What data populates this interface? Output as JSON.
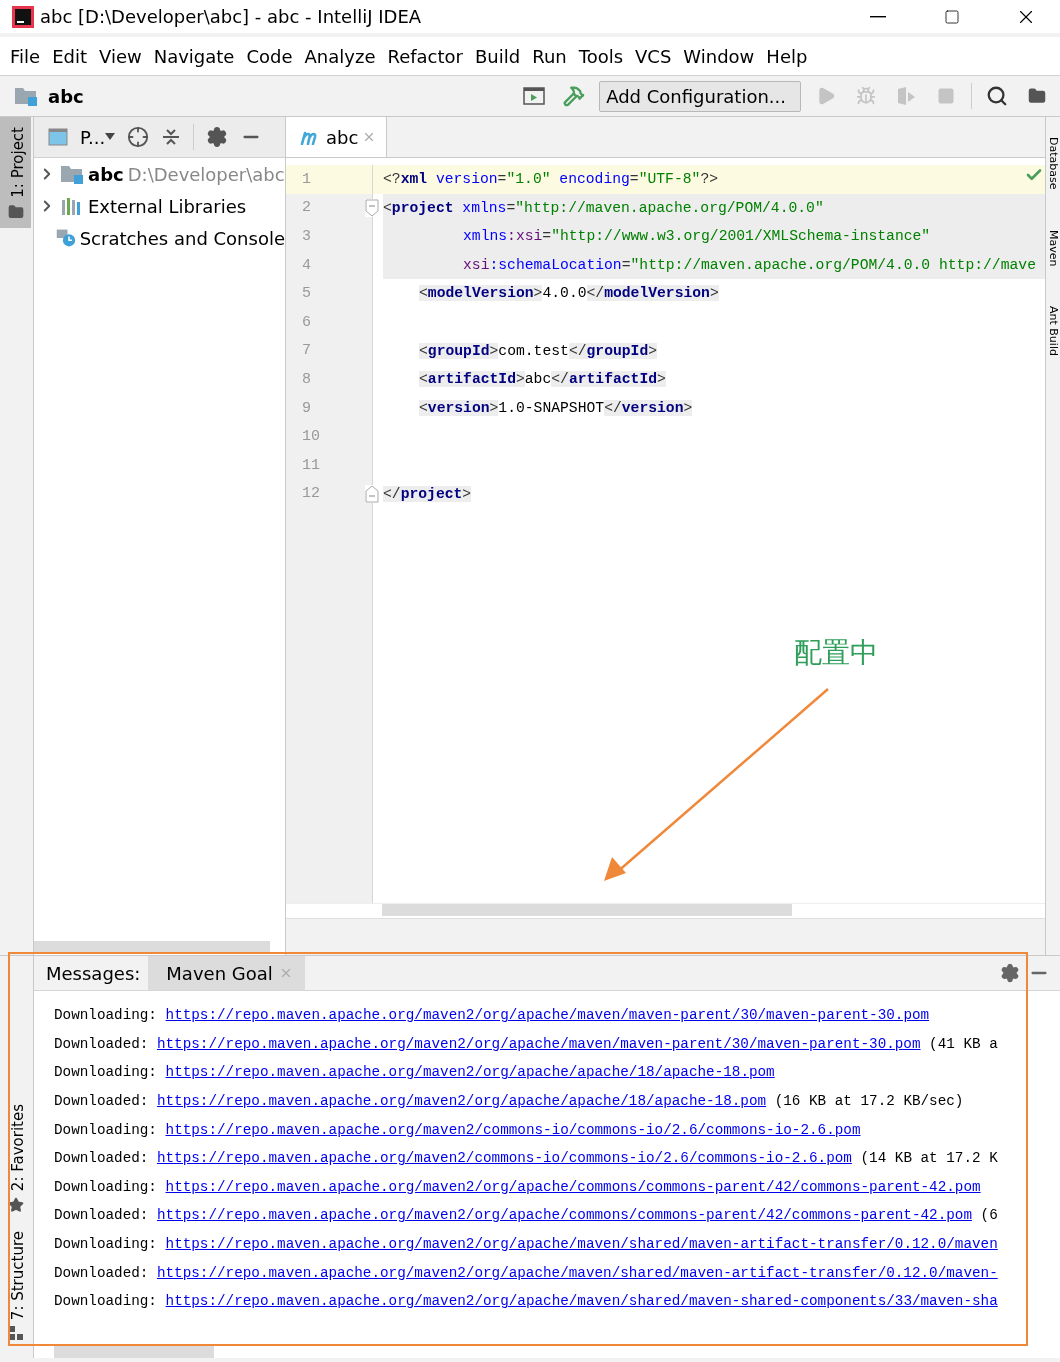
{
  "window": {
    "title": "abc [D:\\Developer\\abc] - abc - IntelliJ IDEA"
  },
  "menu": [
    {
      "label": "File"
    },
    {
      "label": "Edit"
    },
    {
      "label": "View"
    },
    {
      "label": "Navigate"
    },
    {
      "label": "Code"
    },
    {
      "label": "Analyze"
    },
    {
      "label": "Refactor"
    },
    {
      "label": "Build"
    },
    {
      "label": "Run"
    },
    {
      "label": "Tools"
    },
    {
      "label": "VCS"
    },
    {
      "label": "Window"
    },
    {
      "label": "Help"
    }
  ],
  "toolbar": {
    "breadcrumb": "abc",
    "run_config": "Add Configuration..."
  },
  "left_tool_tabs": [
    {
      "label": "1: Project",
      "selected": true,
      "kind": "folder"
    },
    {
      "label": "2: Favorites",
      "selected": false,
      "kind": "star"
    },
    {
      "label": "7: Structure",
      "selected": false,
      "kind": "structure"
    }
  ],
  "right_tool_tabs": [
    {
      "label": "Database"
    },
    {
      "label": "Maven"
    },
    {
      "label": "Ant Build"
    }
  ],
  "project_panel": {
    "view_selector": "P...",
    "tree": [
      {
        "kind": "module",
        "name": "abc",
        "path": "D:\\Developer\\abc",
        "expanded": false
      },
      {
        "kind": "libraries",
        "name": "External Libraries",
        "expanded": false
      },
      {
        "kind": "scratches",
        "name": "Scratches and Console"
      }
    ]
  },
  "editor": {
    "tabs": [
      {
        "label": "abc",
        "selected": true
      }
    ],
    "lines": [
      {
        "number": "1",
        "current": true,
        "matched": false,
        "kind": "top",
        "fold_start": false,
        "fold_end": false,
        "tokens": [
          {
            "kind": "punct",
            "text": "<?"
          },
          {
            "kind": "tag",
            "text": "xml"
          },
          {
            "kind": "attr",
            "text": " version"
          },
          {
            "kind": "punct",
            "text": "="
          },
          {
            "kind": "value",
            "text": "\"1.0\""
          },
          {
            "kind": "attr",
            "text": " encoding"
          },
          {
            "kind": "punct",
            "text": "="
          },
          {
            "kind": "value",
            "text": "\"UTF-8\""
          },
          {
            "kind": "punct",
            "text": "?>"
          }
        ]
      },
      {
        "number": "2",
        "current": false,
        "matched": true,
        "kind": "top",
        "fold_start": true,
        "fold_end": false,
        "tokens": [
          {
            "kind": "punct",
            "text": "<"
          },
          {
            "kind": "tag",
            "text": "project"
          },
          {
            "kind": "attr",
            "text": " xmlns"
          },
          {
            "kind": "punct",
            "text": "="
          },
          {
            "kind": "value",
            "text": "\"http://maven.apache.org/POM/4.0.0\""
          }
        ]
      },
      {
        "number": "3",
        "current": false,
        "matched": true,
        "kind": "attribute",
        "fold_start": false,
        "fold_end": false,
        "tokens": [
          {
            "kind": "attr",
            "text": "xmlns"
          },
          {
            "kind": "ns",
            "text": ":xsi"
          },
          {
            "kind": "punct",
            "text": "="
          },
          {
            "kind": "value",
            "text": "\"http://www.w3.org/2001/XMLSchema-instance\""
          }
        ]
      },
      {
        "number": "4",
        "current": false,
        "matched": true,
        "kind": "attribute",
        "fold_start": false,
        "fold_end": false,
        "tokens": [
          {
            "kind": "ns",
            "text": "xsi"
          },
          {
            "kind": "attr",
            "text": ":schemaLocation"
          },
          {
            "kind": "punct",
            "text": "="
          },
          {
            "kind": "value",
            "text": "\"http://maven.apache.org/POM/4.0.0 http://mave"
          }
        ]
      },
      {
        "number": "5",
        "current": false,
        "matched": false,
        "kind": "child",
        "fold_start": false,
        "fold_end": false,
        "tokens": [
          {
            "kind": "punct",
            "text": "<"
          },
          {
            "kind": "tag",
            "text": "modelVersion"
          },
          {
            "kind": "punct",
            "text": ">"
          },
          {
            "kind": "text",
            "text": "4.0.0"
          },
          {
            "kind": "punct",
            "text": "</"
          },
          {
            "kind": "tag",
            "text": "modelVersion"
          },
          {
            "kind": "punct",
            "text": ">"
          }
        ]
      },
      {
        "number": "6",
        "current": false,
        "matched": false,
        "fold_start": false,
        "fold_end": false
      },
      {
        "number": "7",
        "current": false,
        "matched": false,
        "kind": "child",
        "fold_start": false,
        "fold_end": false,
        "tokens": [
          {
            "kind": "punct",
            "text": "<"
          },
          {
            "kind": "tag",
            "text": "groupId"
          },
          {
            "kind": "punct",
            "text": ">"
          },
          {
            "kind": "text",
            "text": "com.test"
          },
          {
            "kind": "punct",
            "text": "</"
          },
          {
            "kind": "tag",
            "text": "groupId"
          },
          {
            "kind": "punct",
            "text": ">"
          }
        ]
      },
      {
        "number": "8",
        "current": false,
        "matched": false,
        "kind": "child",
        "fold_start": false,
        "fold_end": false,
        "tokens": [
          {
            "kind": "punct",
            "text": "<"
          },
          {
            "kind": "tag",
            "text": "artifactId"
          },
          {
            "kind": "punct",
            "text": ">"
          },
          {
            "kind": "text",
            "text": "abc"
          },
          {
            "kind": "punct",
            "text": "</"
          },
          {
            "kind": "tag",
            "text": "artifactId"
          },
          {
            "kind": "punct",
            "text": ">"
          }
        ]
      },
      {
        "number": "9",
        "current": false,
        "matched": false,
        "kind": "child",
        "fold_start": false,
        "fold_end": false,
        "tokens": [
          {
            "kind": "punct",
            "text": "<"
          },
          {
            "kind": "tag",
            "text": "version"
          },
          {
            "kind": "punct",
            "text": ">"
          },
          {
            "kind": "text",
            "text": "1.0-SNAPSHOT"
          },
          {
            "kind": "punct",
            "text": "</"
          },
          {
            "kind": "tag",
            "text": "version"
          },
          {
            "kind": "punct",
            "text": ">"
          }
        ]
      },
      {
        "number": "10",
        "current": false,
        "matched": false,
        "fold_start": false,
        "fold_end": false
      },
      {
        "number": "11",
        "current": false,
        "matched": false,
        "fold_start": false,
        "fold_end": false
      },
      {
        "number": "12",
        "current": false,
        "matched": false,
        "kind": "top",
        "fold_start": false,
        "fold_end": true,
        "tokens": [
          {
            "kind": "punct",
            "text": "</"
          },
          {
            "kind": "tag",
            "text": "project"
          },
          {
            "kind": "punct",
            "text": ">"
          }
        ]
      }
    ]
  },
  "messages_panel": {
    "title": "Messages:",
    "tabs": [
      {
        "label": "Maven Goal",
        "selected": true
      }
    ],
    "lines": [
      {
        "label": "Downloading:",
        "url": "https://repo.maven.apache.org/maven2/org/apache/maven/maven-parent/30/maven-parent-30.pom"
      },
      {
        "label": "Downloaded:",
        "url": "https://repo.maven.apache.org/maven2/org/apache/maven/maven-parent/30/maven-parent-30.pom",
        "suffix": "(41 KB a"
      },
      {
        "label": "Downloading:",
        "url": "https://repo.maven.apache.org/maven2/org/apache/apache/18/apache-18.pom"
      },
      {
        "label": "Downloaded:",
        "url": "https://repo.maven.apache.org/maven2/org/apache/apache/18/apache-18.pom",
        "suffix": "(16 KB at 17.2 KB/sec)"
      },
      {
        "label": "Downloading:",
        "url": "https://repo.maven.apache.org/maven2/commons-io/commons-io/2.6/commons-io-2.6.pom"
      },
      {
        "label": "Downloaded:",
        "url": "https://repo.maven.apache.org/maven2/commons-io/commons-io/2.6/commons-io-2.6.pom",
        "suffix": "(14 KB at 17.2 K"
      },
      {
        "label": "Downloading:",
        "url": "https://repo.maven.apache.org/maven2/org/apache/commons/commons-parent/42/commons-parent-42.pom"
      },
      {
        "label": "Downloaded:",
        "url": "https://repo.maven.apache.org/maven2/org/apache/commons/commons-parent/42/commons-parent-42.pom",
        "suffix": "(6"
      },
      {
        "label": "Downloading:",
        "url": "https://repo.maven.apache.org/maven2/org/apache/maven/shared/maven-artifact-transfer/0.12.0/maven"
      },
      {
        "label": "Downloaded:",
        "url": "https://repo.maven.apache.org/maven2/org/apache/maven/shared/maven-artifact-transfer/0.12.0/maven-"
      },
      {
        "label": "Downloading:",
        "url": "https://repo.maven.apache.org/maven2/org/apache/maven/shared/maven-shared-components/33/maven-sha"
      }
    ]
  },
  "annotation": {
    "label": "配置中"
  }
}
